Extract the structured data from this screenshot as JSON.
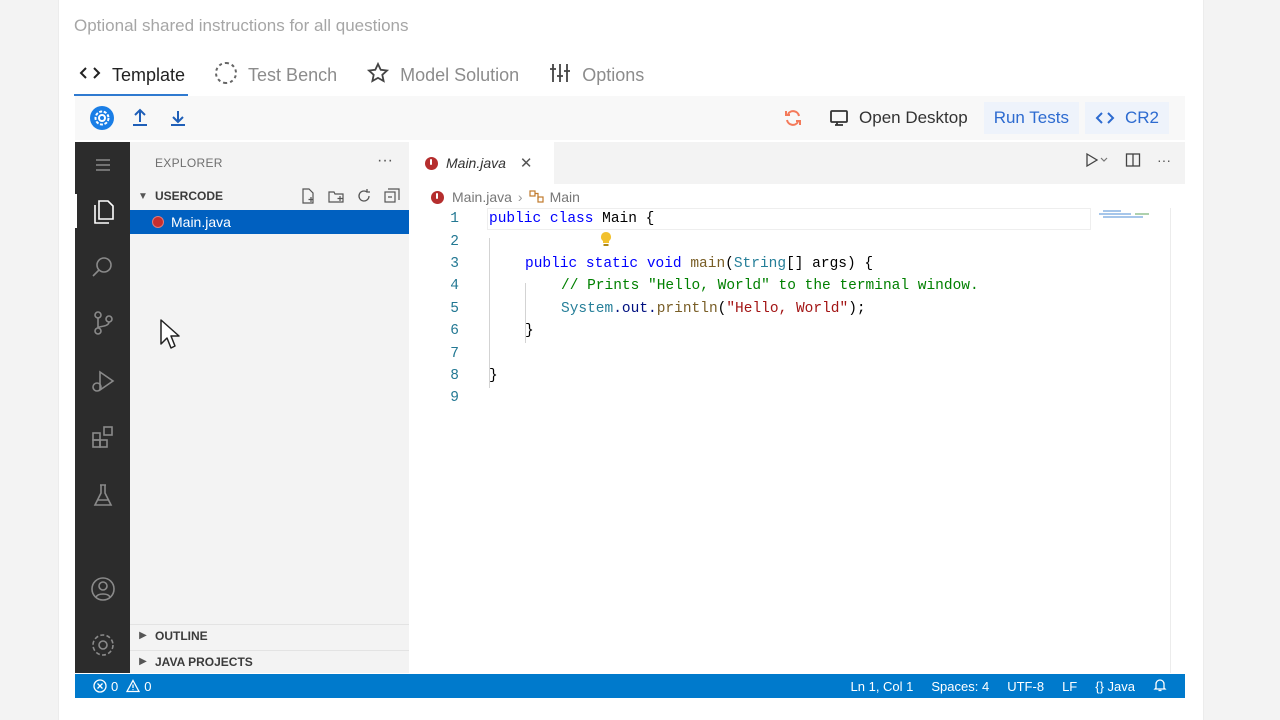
{
  "shared_instructions_placeholder": "Optional shared instructions for all questions",
  "tabs": [
    {
      "label": "Template",
      "icon": "code-brackets-icon",
      "active": true
    },
    {
      "label": "Test Bench",
      "icon": "loading-circle-icon",
      "active": false
    },
    {
      "label": "Model Solution",
      "icon": "star-icon",
      "active": false
    },
    {
      "label": "Options",
      "icon": "sliders-icon",
      "active": false
    }
  ],
  "toolbar": {
    "open_desktop_label": "Open Desktop",
    "run_tests_label": "Run Tests",
    "cr2_label": "CR2"
  },
  "explorer": {
    "title": "EXPLORER",
    "more": "···",
    "workspace_label": "USERCODE",
    "files": [
      {
        "name": "Main.java"
      }
    ],
    "outline_label": "OUTLINE",
    "java_projects_label": "JAVA PROJECTS"
  },
  "editor": {
    "tab_label": "Main.java",
    "tab_close": "✕",
    "breadcrumb_file": "Main.java",
    "breadcrumb_symbol": "Main",
    "lines": [
      {
        "n": "1"
      },
      {
        "n": "2"
      },
      {
        "n": "3"
      },
      {
        "n": "4"
      },
      {
        "n": "5"
      },
      {
        "n": "6"
      },
      {
        "n": "7"
      },
      {
        "n": "8"
      },
      {
        "n": "9"
      }
    ],
    "code": {
      "l1_kw": "public class",
      "l1_name": " Main {",
      "l3_kw": "public static void",
      "l3_fn": " main",
      "l3_type": "String",
      "l3_rest": "[] args) {",
      "l4_comment": "// Prints \"Hello, World\" to the terminal window.",
      "l5_obj": "System",
      "l5_out": ".out.",
      "l5_fn": "println",
      "l5_str": "\"Hello, World\"",
      "l5_end": ");",
      "l6": "}",
      "l8": "}"
    }
  },
  "statusbar": {
    "errors": "0",
    "warnings": "0",
    "position": "Ln 1, Col 1",
    "spaces": "Spaces: 4",
    "encoding": "UTF-8",
    "eol": "LF",
    "language": "Java"
  },
  "colors": {
    "accent": "#2f7ad0",
    "statusbar": "#007acc",
    "activity_bar": "#2c2c2c",
    "selection": "#0060c0"
  }
}
